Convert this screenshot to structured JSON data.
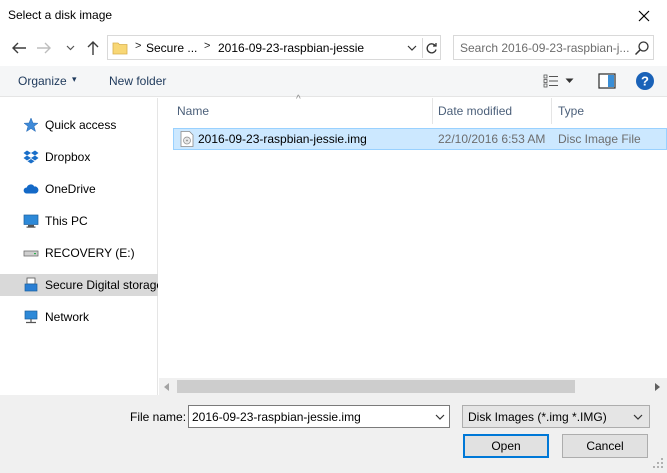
{
  "window": {
    "title": "Select a disk image",
    "close_icon": "close-icon"
  },
  "nav": {
    "back_icon": "arrow-left-icon",
    "forward_icon": "arrow-right-icon",
    "recent_icon": "chevron-down-icon",
    "up_icon": "arrow-up-icon"
  },
  "address": {
    "separator": ">",
    "crumbs": [
      "Secure ...",
      "2016-09-23-raspbian-jessie"
    ],
    "folder_icon": "folder-icon",
    "refresh_icon": "refresh-icon"
  },
  "search": {
    "placeholder": "Search 2016-09-23-raspbian-j...",
    "icon": "search-icon"
  },
  "toolbar": {
    "organize_label": "Organize",
    "organize_arrow": "▾",
    "new_folder_label": "New folder",
    "view_icon": "view-details-icon",
    "preview_icon": "preview-pane-icon",
    "help_icon": "help-icon"
  },
  "sidebar": {
    "items": [
      {
        "label": "Quick access",
        "icon": "star-icon"
      },
      {
        "label": "Dropbox",
        "icon": "dropbox-icon"
      },
      {
        "label": "OneDrive",
        "icon": "cloud-icon"
      },
      {
        "label": "This PC",
        "icon": "computer-icon"
      },
      {
        "label": "RECOVERY (E:)",
        "icon": "drive-icon"
      },
      {
        "label": "Secure Digital storage",
        "icon": "usb-drive-icon",
        "selected": true
      },
      {
        "label": "Network",
        "icon": "network-icon"
      }
    ]
  },
  "columns": {
    "name": "Name",
    "date_modified": "Date modified",
    "type": "Type",
    "sort_glyph": "^"
  },
  "files": [
    {
      "name": "2016-09-23-raspbian-jessie.img",
      "date_modified": "22/10/2016 6:53 AM",
      "type": "Disc Image File",
      "icon": "disc-image-file-icon"
    }
  ],
  "bottom": {
    "file_name_label": "File name:",
    "file_name_value": "2016-09-23-raspbian-jessie.img",
    "filter_value": "Disk Images (*.img *.IMG)",
    "open_label": "Open",
    "cancel_label": "Cancel"
  },
  "colors": {
    "selection": "#cce8ff",
    "selection_border": "#99d1ff",
    "accent": "#0078d7",
    "help": "#1a62b8"
  }
}
